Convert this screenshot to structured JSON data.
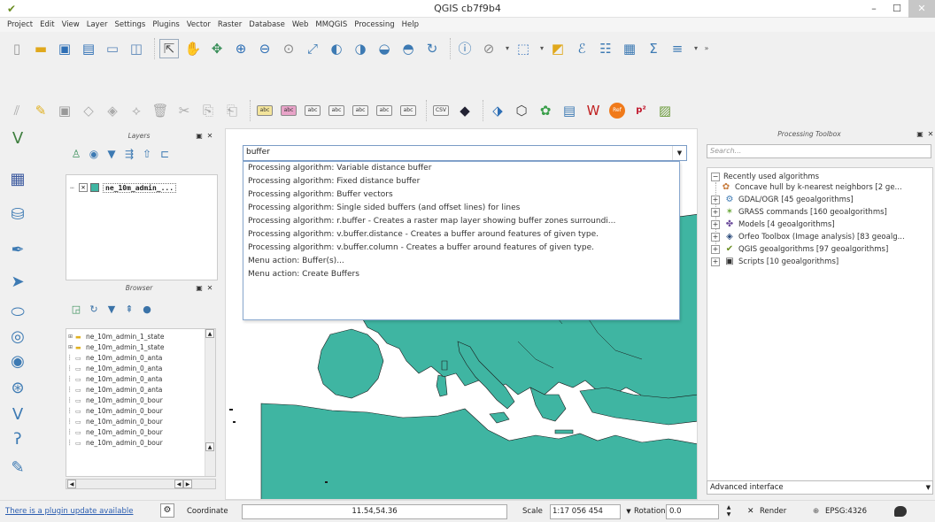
{
  "window": {
    "title": "QGIS cb7f9b4"
  },
  "menubar": [
    "Project",
    "Edit",
    "View",
    "Layer",
    "Settings",
    "Plugins",
    "Vector",
    "Raster",
    "Database",
    "Web",
    "MMQGIS",
    "Processing",
    "Help"
  ],
  "toolbar1": {
    "icons": [
      "new-project-icon",
      "open-project-icon",
      "save-project-icon",
      "save-as-icon",
      "print-composer-icon",
      "composer-manager-icon",
      "pan-select-icon",
      "pan-icon",
      "pan-to-selection-icon",
      "zoom-in-icon",
      "zoom-out-icon",
      "zoom-native-icon",
      "zoom-full-icon",
      "zoom-to-layer-icon",
      "zoom-to-selection-icon",
      "zoom-last-icon",
      "zoom-next-icon",
      "refresh-icon",
      "identify-icon",
      "measure-icon",
      "select-icon",
      "add-vector-icon",
      "style-icon",
      "attribute-table-icon",
      "field-calculator-icon",
      "statistics-icon",
      "annotation-icon"
    ],
    "more": "»"
  },
  "toolbar2": {
    "labels": [
      "abc",
      "abc",
      "abc",
      "abc",
      "abc",
      "abc",
      "abc",
      "CSV",
      "Ref",
      "p²"
    ]
  },
  "layers_panel": {
    "title": "Layers",
    "layer": {
      "name": "ne_10m_admin_...",
      "checked": "✕",
      "color": "#3fb5a2"
    }
  },
  "browser_panel": {
    "title": "Browser",
    "items": [
      "ne_10m_admin_1_state",
      "ne_10m_admin_1_state",
      "ne_10m_admin_0_anta",
      "ne_10m_admin_0_anta",
      "ne_10m_admin_0_anta",
      "ne_10m_admin_0_anta",
      "ne_10m_admin_0_bour",
      "ne_10m_admin_0_bour",
      "ne_10m_admin_0_bour",
      "ne_10m_admin_0_bour",
      "ne_10m_admin_0_bour"
    ]
  },
  "locator": {
    "query": "buffer",
    "suggestions": [
      "Processing algorithm: Variable distance buffer",
      "Processing algorithm: Fixed distance buffer",
      "Processing algorithm: Buffer vectors",
      "Processing algorithm: Single sided buffers (and offset lines) for lines",
      "Processing algorithm: r.buffer - Creates a raster map layer showing buffer zones surroundi...",
      "Processing algorithm: v.buffer.distance - Creates a buffer around features of given type.",
      "Processing algorithm: v.buffer.column - Creates a buffer around features of given type.",
      "Menu action: Buffer(s)...",
      "Menu action: Create Buffers"
    ]
  },
  "toolbox": {
    "title": "Processing Toolbox",
    "search_placeholder": "Search...",
    "nodes": [
      "Recently used algorithms",
      "Concave hull by k-nearest neighbors [2 ge...",
      "GDAL/OGR [45 geoalgorithms]",
      "GRASS commands [160 geoalgorithms]",
      "Models [4 geoalgorithms]",
      "Orfeo Toolbox (Image analysis) [83 geoalg...",
      "QGIS geoalgorithms [97 geoalgorithms]",
      "Scripts [10 geoalgorithms]"
    ],
    "advanced": "Advanced interface"
  },
  "status": {
    "plugin_update": "There is a plugin update available",
    "coordinate_label": "Coordinate",
    "coordinate": "11.54,54.36",
    "scale_label": "Scale",
    "scale": "1:17 056 454",
    "rotation_label": "Rotation",
    "rotation": "0.0",
    "render": "Render",
    "crs": "EPSG:4326"
  },
  "colors": {
    "land": "#3fb5a2",
    "sea": "#ffffff",
    "accent": "#2a5db0"
  }
}
